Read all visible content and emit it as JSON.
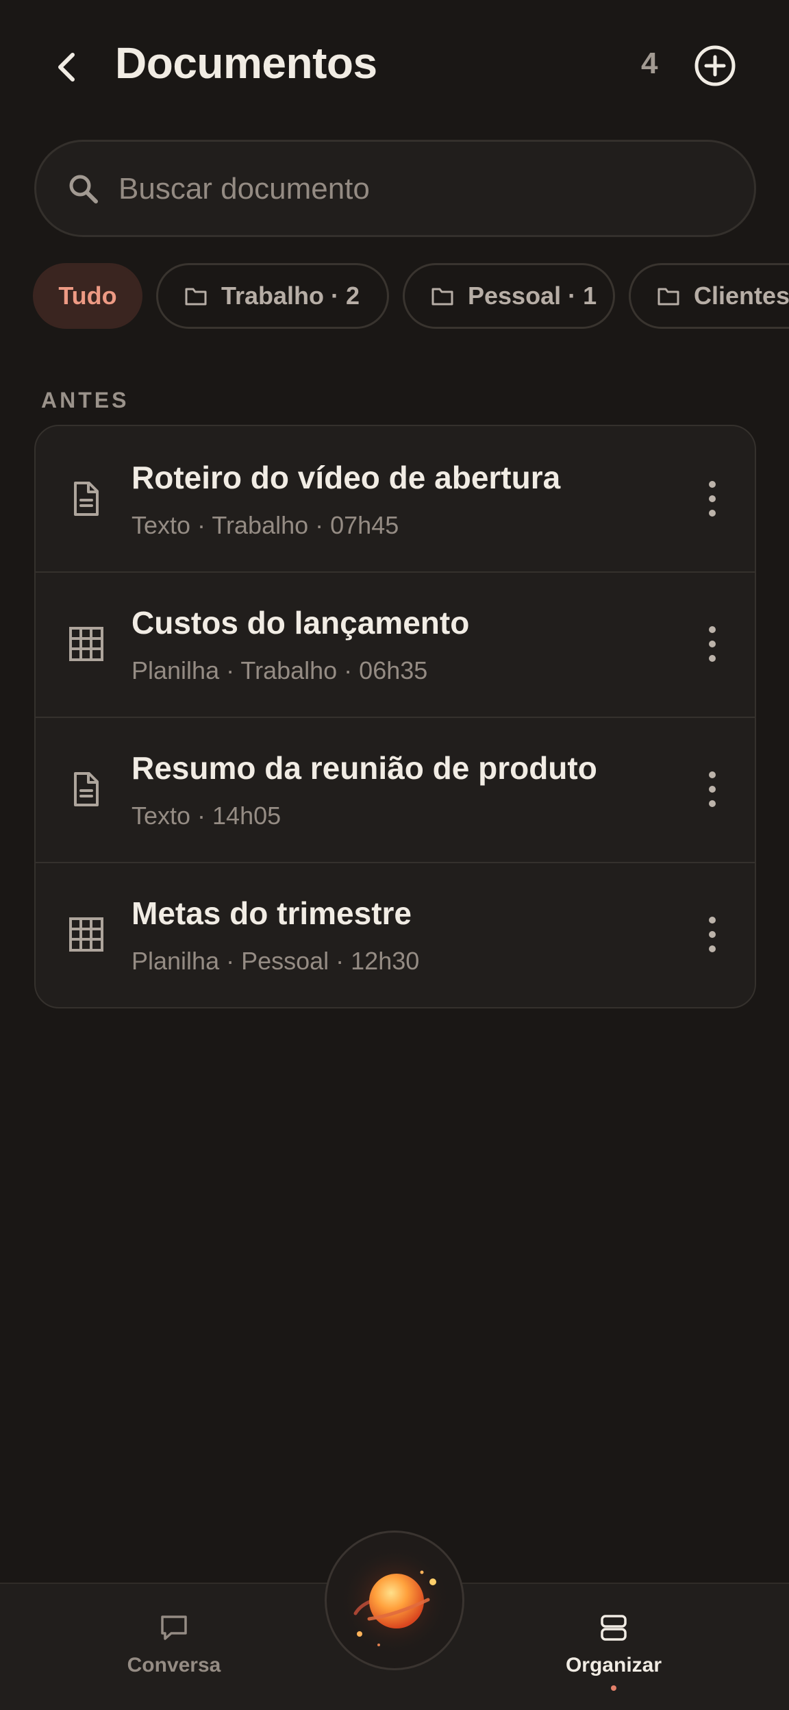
{
  "header": {
    "title": "Documentos",
    "count": "4"
  },
  "search": {
    "placeholder": "Buscar documento",
    "value": ""
  },
  "filters": [
    {
      "label": "Tudo",
      "active": true
    },
    {
      "label": "Trabalho · 2",
      "icon": "folder-icon"
    },
    {
      "label": "Pessoal · 1",
      "icon": "folder-icon"
    },
    {
      "label": "Clientes",
      "icon": "folder-icon"
    }
  ],
  "section": {
    "label": "ANTES"
  },
  "documents": [
    {
      "title": "Roteiro do vídeo de abertura",
      "meta": "Texto · Trabalho · 07h45",
      "icon": "document-text-icon"
    },
    {
      "title": "Custos do lançamento",
      "meta": "Planilha · Trabalho · 06h35",
      "icon": "spreadsheet-grid-icon"
    },
    {
      "title": "Resumo da reunião de produto",
      "meta": "Texto · 14h05",
      "icon": "document-text-icon"
    },
    {
      "title": "Metas do trimestre",
      "meta": "Planilha · Pessoal · 12h30",
      "icon": "spreadsheet-grid-icon"
    }
  ],
  "bottom_nav": {
    "left_label": "Conversa",
    "right_label": "Organizar",
    "active": "Organizar"
  },
  "colors": {
    "background": "#1a1715",
    "surface": "#211e1c",
    "accent": "#ed9a84",
    "accent_bg": "#3a2520",
    "text_primary": "#f1ece4",
    "text_secondary": "#958c84"
  }
}
